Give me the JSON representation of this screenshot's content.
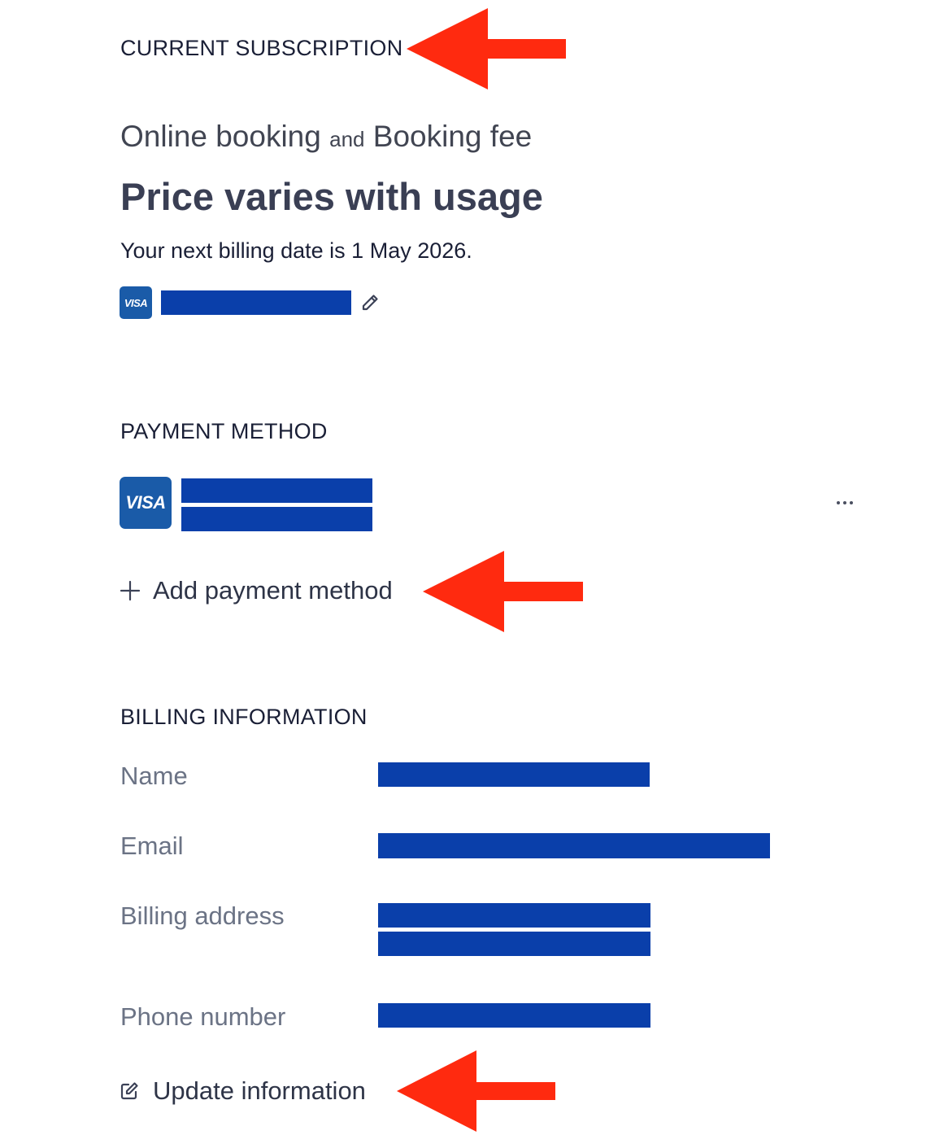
{
  "subscription": {
    "heading": "CURRENT SUBSCRIPTION",
    "product_main": "Online booking",
    "product_connector": "and",
    "product_secondary": "Booking fee",
    "price_text": "Price varies with usage",
    "billing_date_text": "Your next billing date is 1 May 2026.",
    "card_brand": "VISA",
    "edit_icon": "pencil-icon"
  },
  "payment": {
    "heading": "PAYMENT METHOD",
    "card_brand": "VISA",
    "more_icon": "more-horizontal-icon",
    "add_label": "Add payment method",
    "add_icon": "plus-icon"
  },
  "billing": {
    "heading": "BILLING INFORMATION",
    "fields": [
      {
        "label": "Name"
      },
      {
        "label": "Email"
      },
      {
        "label": "Billing address"
      },
      {
        "label": "Phone number"
      }
    ],
    "update_label": "Update information",
    "update_icon": "edit-square-icon"
  },
  "annotations": {
    "arrow_color": "#ff2a0f",
    "arrow_icon": "left-arrow-annotation"
  },
  "colors": {
    "redaction": "#0a3faa",
    "visa_blue": "#1a5ba8",
    "heading_text": "#1a1f36",
    "muted_label": "#6b7385"
  }
}
